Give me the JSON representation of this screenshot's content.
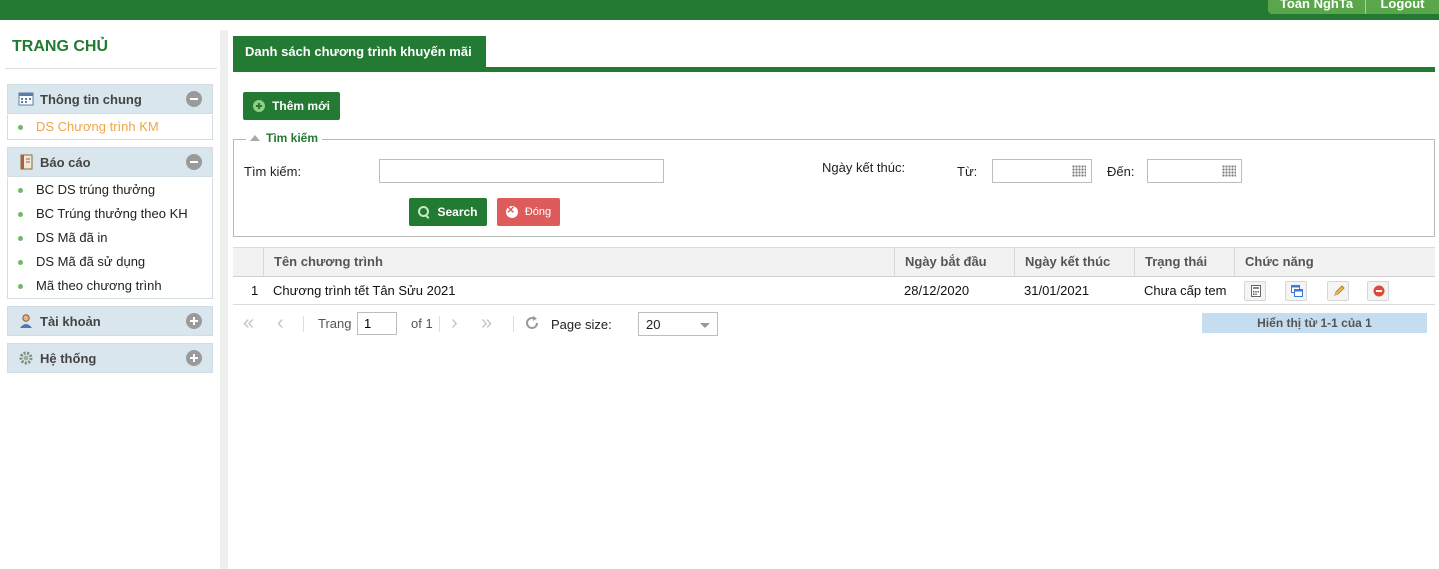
{
  "topbar": {
    "user_label": "Toàn NghTa",
    "logout_label": "Logout"
  },
  "sidebar": {
    "title": "TRANG CHỦ",
    "groups": [
      {
        "label": "Thông tin chung",
        "icon": "calendar-icon",
        "expanded": true,
        "items": [
          {
            "label": "DS Chương trình KM",
            "active": true
          }
        ]
      },
      {
        "label": "Báo cáo",
        "icon": "report-book-icon",
        "expanded": true,
        "items": [
          {
            "label": "BC DS trúng thưởng"
          },
          {
            "label": "BC Trúng thưởng theo KH"
          },
          {
            "label": "DS Mã đã in"
          },
          {
            "label": "DS Mã đã sử dụng"
          },
          {
            "label": "Mã theo chương trình"
          }
        ]
      },
      {
        "label": "Tài khoản",
        "icon": "user-icon",
        "expanded": false,
        "items": []
      },
      {
        "label": "Hệ thống",
        "icon": "gear-icon",
        "expanded": false,
        "items": []
      }
    ]
  },
  "main": {
    "tab_label": "Danh sách chương trình khuyến mãi",
    "add_button": "Thêm mới",
    "search_panel": {
      "legend": "Tìm kiếm",
      "search_label": "Tìm kiếm:",
      "search_value": "",
      "end_date_label": "Ngày kết thúc:",
      "from_label": "Từ:",
      "to_label": "Đến:",
      "from_value": "",
      "to_value": "",
      "search_button": "Search",
      "close_button": "Đóng"
    },
    "grid": {
      "columns": [
        "Tên chương trình",
        "Ngày bắt đầu",
        "Ngày kết thúc",
        "Trạng thái",
        "Chức năng"
      ],
      "rows": [
        {
          "index": "1",
          "name": "Chương trình tết Tân Sửu 2021",
          "start": "28/12/2020",
          "end": "31/01/2021",
          "status": "Chưa cấp tem",
          "actions": [
            "calculator-icon",
            "windows-icon",
            "pencil-icon",
            "delete-icon"
          ]
        }
      ]
    },
    "pager": {
      "page_label": "Trang",
      "page_value": "1",
      "of_label": "of 1",
      "page_size_label": "Page size:",
      "page_size_value": "20",
      "info": "Hiển thị từ 1-1 của 1"
    }
  },
  "colors": {
    "brand": "#237a32",
    "accent_active": "#f0a54a",
    "danger": "#de5b5b",
    "group_bg": "#d9e6ee"
  }
}
